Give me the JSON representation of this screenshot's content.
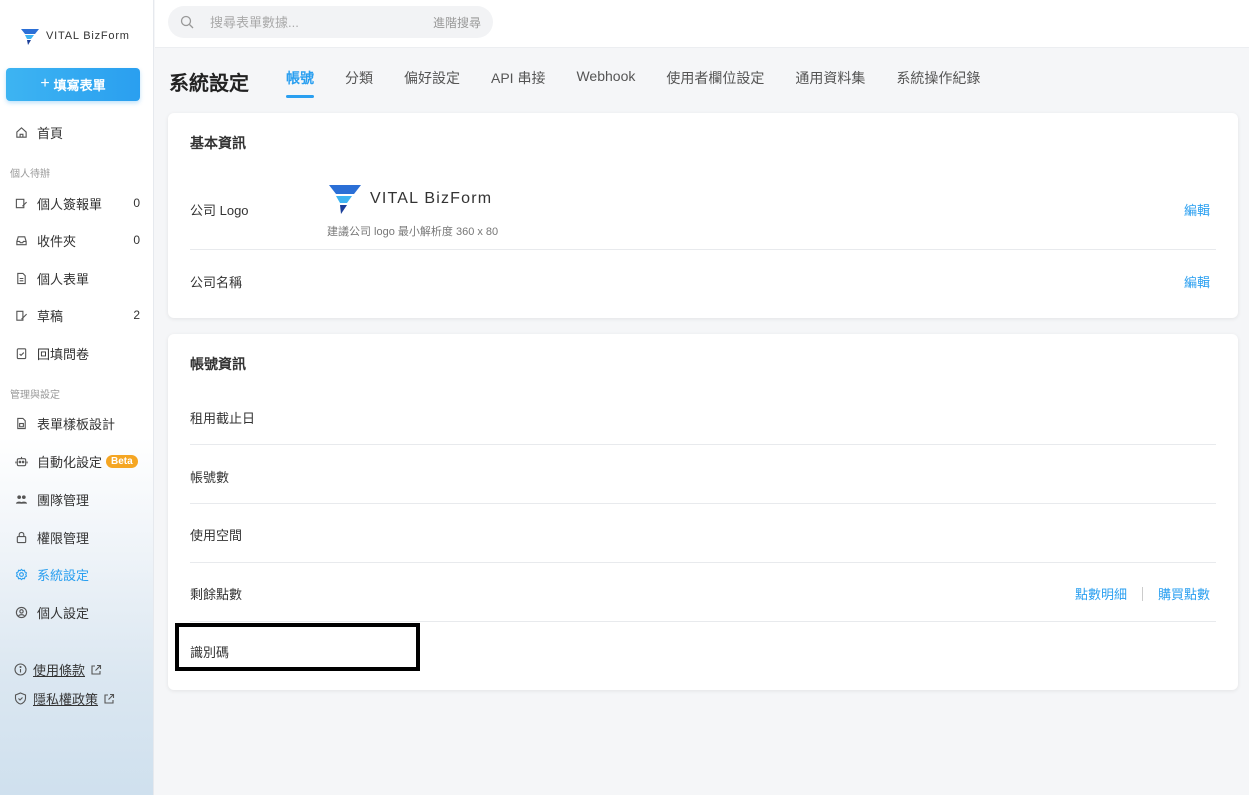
{
  "brand": {
    "name": "VITAL BizForm"
  },
  "sidebar": {
    "fill_button_label": "填寫表單",
    "home_label": "首頁",
    "personal_section": "個人待辦",
    "personal_items": [
      {
        "label": "個人簽報單",
        "count": "0"
      },
      {
        "label": "收件夾",
        "count": "0"
      },
      {
        "label": "個人表單",
        "count": ""
      },
      {
        "label": "草稿",
        "count": "2"
      },
      {
        "label": "回填問卷",
        "count": ""
      }
    ],
    "admin_section": "管理與設定",
    "admin_items": [
      {
        "label": "表單樣板設計"
      },
      {
        "label": "自動化設定",
        "badge": "Beta"
      },
      {
        "label": "團隊管理"
      },
      {
        "label": "權限管理"
      },
      {
        "label": "系統設定"
      },
      {
        "label": "個人設定"
      }
    ],
    "terms_label": "使用條款",
    "privacy_label": "隱私權政策"
  },
  "search": {
    "placeholder": "搜尋表單數據...",
    "advanced_label": "進階搜尋"
  },
  "header": {
    "title": "系統設定",
    "tabs": [
      "帳號",
      "分類",
      "偏好設定",
      "API 串接",
      "Webhook",
      "使用者欄位設定",
      "通用資料集",
      "系統操作紀錄"
    ],
    "active_tab": "帳號"
  },
  "basic_info": {
    "title": "基本資訊",
    "logo_label": "公司 Logo",
    "logo_hint": "建議公司 logo 最小解析度 360 x 80",
    "edit_label": "編輯",
    "company_name_label": "公司名稱"
  },
  "account_info": {
    "title": "帳號資訊",
    "rows": [
      "租用截止日",
      "帳號數",
      "使用空間",
      "剩餘點數",
      "識別碼"
    ],
    "points_detail_label": "點數明細",
    "buy_points_label": "購買點數"
  },
  "colors": {
    "accent": "#2a9ff0",
    "beta": "#f5a623"
  }
}
